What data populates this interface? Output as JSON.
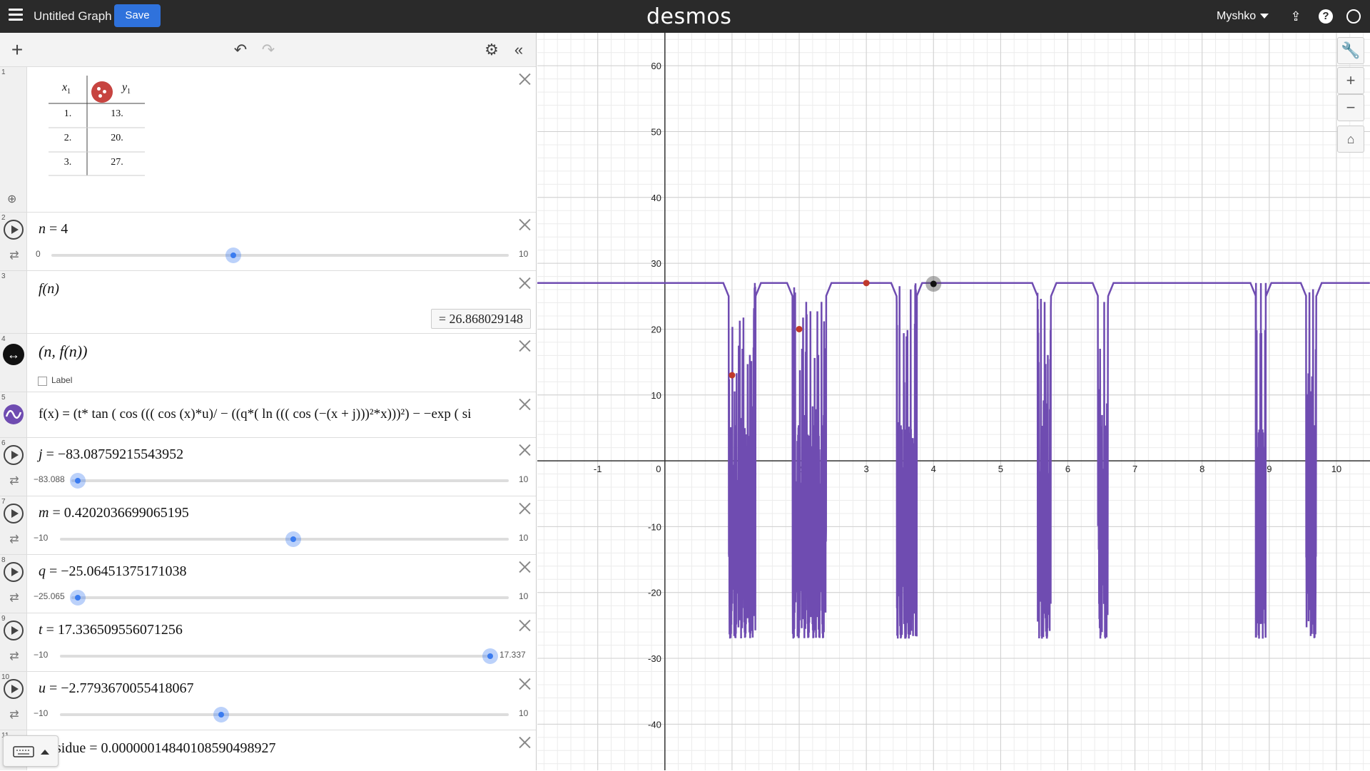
{
  "topbar": {
    "title": "Untitled Graph",
    "save_label": "Save",
    "logo": "desmos",
    "user": "Myshko"
  },
  "expressions": [
    {
      "index": "1",
      "type": "table",
      "headers": [
        "x1",
        "y1"
      ],
      "header_x_main": "x",
      "header_x_sub": "1",
      "header_y_main": "y",
      "header_y_sub": "1",
      "rows": [
        [
          "1.",
          "13."
        ],
        [
          "2.",
          "20."
        ],
        [
          "3.",
          "27."
        ]
      ]
    },
    {
      "index": "2",
      "type": "slider",
      "lhs": "n",
      "value": "4",
      "min": "0",
      "max": "10",
      "fraction": 0.4
    },
    {
      "index": "3",
      "type": "expression",
      "latex": "f(n)",
      "result": "= 26.868029148"
    },
    {
      "index": "4",
      "type": "point",
      "latex": "(n, f(n))",
      "label_text": "Label"
    },
    {
      "index": "5",
      "type": "function",
      "latex": "f(x) = (t* tan ( cos ((( cos (x)*u)/ − ((q*( ln ((( cos (−(x + j)))²*x)))²) − −exp ( si"
    },
    {
      "index": "6",
      "type": "slider",
      "lhs": "j",
      "value": "−83.08759215543952",
      "min": "−83.088",
      "max": "10",
      "fraction": 0.0
    },
    {
      "index": "7",
      "type": "slider",
      "lhs": "m",
      "value": "0.4202036699065195",
      "min": "−10",
      "max": "10",
      "fraction": 0.521
    },
    {
      "index": "8",
      "type": "slider",
      "lhs": "q",
      "value": "−25.06451375171038",
      "min": "−25.065",
      "max": "10",
      "fraction": 0.0
    },
    {
      "index": "9",
      "type": "slider",
      "lhs": "t",
      "value": "17.336509556071256",
      "min": "−10",
      "max": "17.337",
      "fraction": 1.0
    },
    {
      "index": "10",
      "type": "slider",
      "lhs": "u",
      "value": "−2.7793670055418067",
      "min": "−10",
      "max": "10",
      "fraction": 0.361
    },
    {
      "index": "11",
      "type": "expression",
      "latex": "sidue = 0.0000001484010859049892​7"
    }
  ],
  "graph": {
    "x_ticks": [
      "-1",
      "0",
      "1",
      "2",
      "3",
      "4",
      "5",
      "6",
      "7",
      "8",
      "9",
      "10"
    ],
    "y_ticks": [
      "60",
      "50",
      "40",
      "30",
      "20",
      "10",
      "-10",
      "-20",
      "-30",
      "-40"
    ],
    "x_range": [
      -1.9,
      10.5
    ],
    "y_range": [
      -47,
      65
    ],
    "curve_color": "#6f4cb1",
    "point_color": "#c0392b",
    "highlight_point_color": "#555555"
  },
  "chart_data": {
    "type": "scatter",
    "series": [
      {
        "name": "",
        "x": [
          1,
          2,
          3
        ],
        "y": [
          13,
          20,
          27
        ]
      }
    ],
    "movable_point": {
      "x": 4,
      "y": 26.868029148
    },
    "curve_baseline": 27,
    "curve_dips_to": -27,
    "dip_intervals": [
      [
        0.95,
        1.35
      ],
      [
        1.9,
        2.4
      ],
      [
        3.45,
        3.75
      ],
      [
        5.55,
        5.75
      ],
      [
        6.45,
        6.6
      ],
      [
        8.8,
        8.95
      ],
      [
        9.55,
        9.7
      ]
    ],
    "xlim": [
      -1.9,
      10.5
    ],
    "ylim": [
      -47,
      65
    ],
    "grid": true
  }
}
